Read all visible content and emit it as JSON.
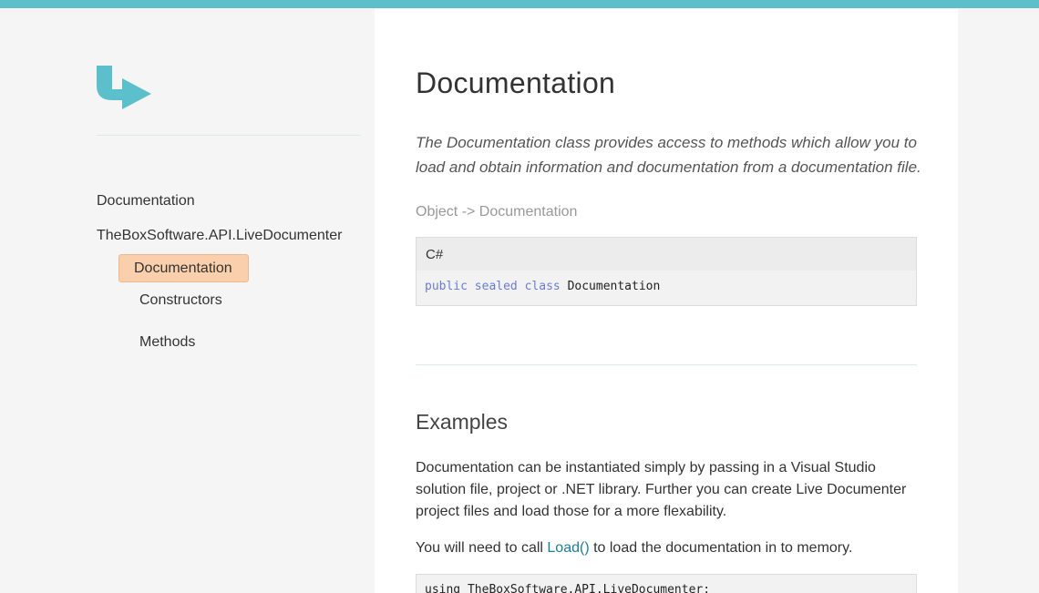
{
  "colors": {
    "accent": "#5bc0cc",
    "active_nav_bg": "#f9d0ab",
    "keyword": "#6b7bd6",
    "link": "#1a7f9a"
  },
  "logo": {
    "icon": "arrow-right-logo-icon"
  },
  "sidebar": {
    "items": [
      {
        "label": "Documentation"
      },
      {
        "label": "TheBoxSoftware.API.LiveDocumenter"
      },
      {
        "label": "Documentation",
        "active": true
      },
      {
        "label": "Constructors"
      },
      {
        "label": "Methods"
      }
    ]
  },
  "page": {
    "title": "Documentation",
    "lead": "The Documentation class provides access to methods which allow you to load and obtain information and documentation from a documentation file.",
    "inheritance": "Object -> Documentation"
  },
  "syntax": {
    "language": "C#",
    "keywords": [
      "public",
      "sealed",
      "class"
    ],
    "type_name": "Documentation"
  },
  "examples": {
    "title": "Examples",
    "paragraph1": "Documentation can be instantiated simply by passing in a Visual Studio solution file, project or .NET library. Further you can create Live Documenter project files and load those for a more flexability.",
    "paragraph2_before": "You will need to call ",
    "paragraph2_link": "Load()",
    "paragraph2_after": " to load the documentation in to memory.",
    "code_line1": "using TheBoxSoftware.API.LiveDocumenter;"
  }
}
